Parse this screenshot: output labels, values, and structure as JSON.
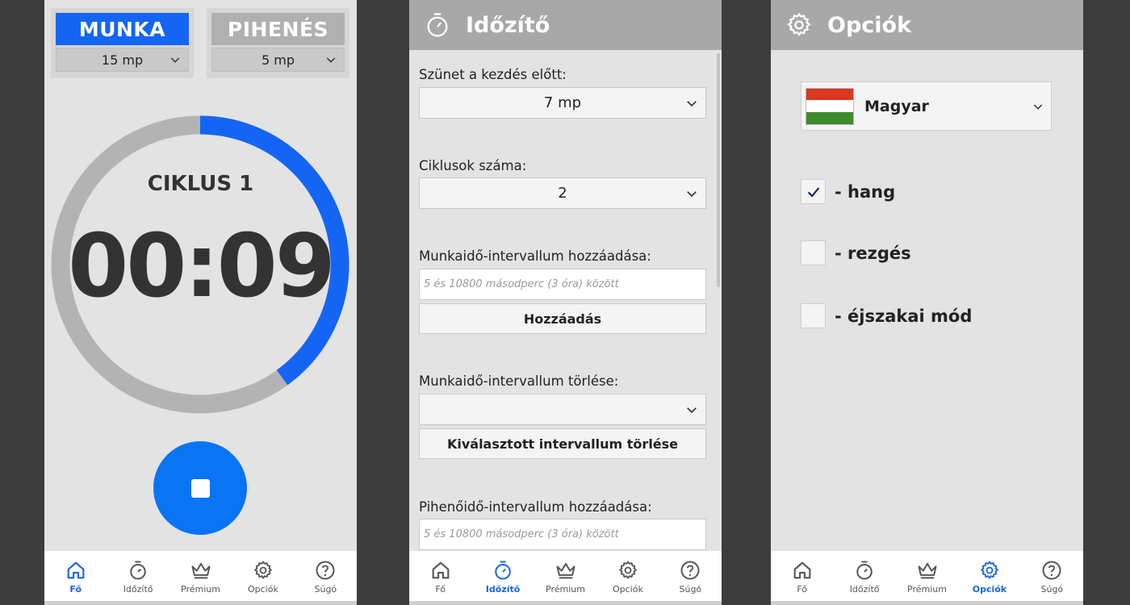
{
  "colors": {
    "accent": "#1565f5",
    "stop_button": "#0a74f5",
    "ring_track": "#b3b3b3",
    "ring_progress": "#1565f5",
    "header": "#a8a8a8"
  },
  "nav": [
    "Fő",
    "Időzítő",
    "Prémium",
    "Opciók",
    "Súgó"
  ],
  "main": {
    "work": {
      "label": "MUNKA",
      "value": "15 mp"
    },
    "rest": {
      "label": "PIHENÉS",
      "value": "5 mp"
    },
    "cycle_label": "CIKLUS 1",
    "time": "00:09",
    "progress_fraction": 0.4,
    "active_nav": 0
  },
  "timer": {
    "title": "Időzítő",
    "pause_label": "Szünet a kezdés előtt:",
    "pause_value": "7 mp",
    "cycles_label": "Ciklusok száma:",
    "cycles_value": "2",
    "add_work_label": "Munkaidő-intervallum hozzáadása:",
    "add_work_placeholder": "5 és 10800 másodperc (3 óra) között",
    "add_button": "Hozzáadás",
    "delete_work_label": "Munkaidő-intervallum törlése:",
    "delete_work_value": "",
    "delete_button": "Kiválasztott intervallum törlése",
    "add_rest_label": "Pihenőidő-intervallum hozzáadása:",
    "add_rest_placeholder": "5 és 10800 másodperc (3 óra) között",
    "active_nav": 1
  },
  "options": {
    "title": "Opciók",
    "language": "Magyar",
    "flag_colors": [
      "#d9381e",
      "#ffffff",
      "#3d8c2e"
    ],
    "toggles": [
      {
        "label": "- hang",
        "checked": true
      },
      {
        "label": "- rezgés",
        "checked": false
      },
      {
        "label": "- éjszakai mód",
        "checked": false
      }
    ],
    "active_nav": 3
  }
}
